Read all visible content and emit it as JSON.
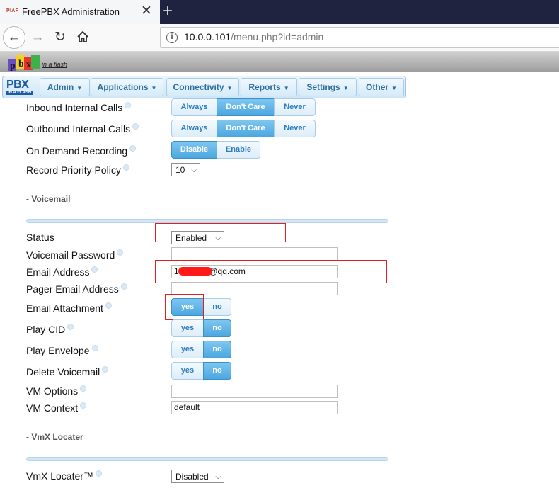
{
  "browser": {
    "tab_favicon": "PIAF",
    "tab_title": "FreePBX Administration",
    "url_host": "10.0.0.101",
    "url_path": "/menu.php?id=admin"
  },
  "app": {
    "piaf_tagline": "in a flash",
    "pbx_logo_text": "PBX",
    "pbx_logo_sub": "IN A FLASH",
    "menu": [
      {
        "label": "Admin"
      },
      {
        "label": "Applications"
      },
      {
        "label": "Connectivity"
      },
      {
        "label": "Reports"
      },
      {
        "label": "Settings"
      },
      {
        "label": "Other"
      }
    ]
  },
  "form": {
    "inbound_internal_calls": {
      "label": "Inbound Internal Calls",
      "options": [
        "Always",
        "Don't Care",
        "Never"
      ],
      "selected": "Don't Care"
    },
    "outbound_internal_calls": {
      "label": "Outbound Internal Calls",
      "options": [
        "Always",
        "Don't Care",
        "Never"
      ],
      "selected": "Don't Care"
    },
    "on_demand_recording": {
      "label": "On Demand Recording",
      "options": [
        "Disable",
        "Enable"
      ],
      "selected": "Disable"
    },
    "record_priority_policy": {
      "label": "Record Priority Policy",
      "value": "10"
    },
    "voicemail_section": "- Voicemail",
    "status": {
      "label": "Status",
      "value": "Enabled"
    },
    "voicemail_password": {
      "label": "Voicemail Password",
      "value": ""
    },
    "email_address": {
      "label": "Email Address",
      "value_prefix": "10",
      "value_suffix": "@qq.com"
    },
    "pager_email_address": {
      "label": "Pager Email Address",
      "value": ""
    },
    "email_attachment": {
      "label": "Email Attachment",
      "options": [
        "yes",
        "no"
      ],
      "selected": "yes"
    },
    "play_cid": {
      "label": "Play CID",
      "options": [
        "yes",
        "no"
      ],
      "selected": "no"
    },
    "play_envelope": {
      "label": "Play Envelope",
      "options": [
        "yes",
        "no"
      ],
      "selected": "no"
    },
    "delete_voicemail": {
      "label": "Delete Voicemail",
      "options": [
        "yes",
        "no"
      ],
      "selected": "no"
    },
    "vm_options": {
      "label": "VM Options",
      "value": ""
    },
    "vm_context": {
      "label": "VM Context",
      "value": "default"
    },
    "vmx_section": "- VmX Locater",
    "vmx_locater": {
      "label": "VmX Locater™",
      "value": "Disabled"
    }
  },
  "colors": {
    "annotation_red": "#e02020",
    "active_button": "#4ba7e0"
  }
}
